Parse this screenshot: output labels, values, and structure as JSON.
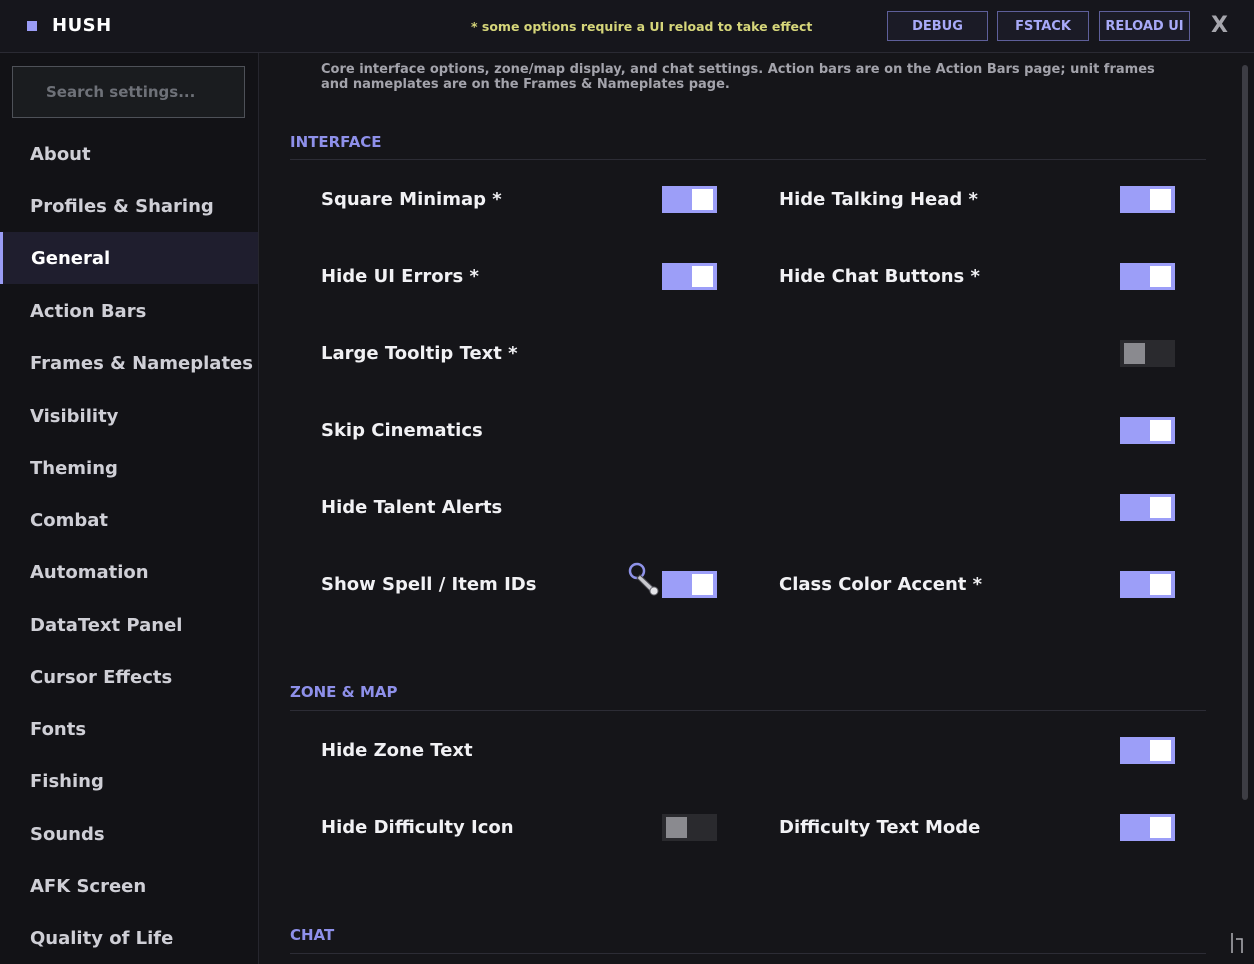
{
  "header": {
    "title": "HUSH",
    "notice": "* some options require a UI reload to take effect",
    "buttons": {
      "debug": "DEBUG",
      "fstack": "FSTACK",
      "reload": "RELOAD UI"
    },
    "close": "X"
  },
  "sidebar": {
    "search_placeholder": "Search settings...",
    "items": [
      {
        "label": "About"
      },
      {
        "label": "Profiles & Sharing"
      },
      {
        "label": "General",
        "active": true
      },
      {
        "label": "Action Bars"
      },
      {
        "label": "Frames & Nameplates"
      },
      {
        "label": "Visibility"
      },
      {
        "label": "Theming"
      },
      {
        "label": "Combat"
      },
      {
        "label": "Automation"
      },
      {
        "label": "DataText Panel"
      },
      {
        "label": "Cursor Effects"
      },
      {
        "label": "Fonts"
      },
      {
        "label": "Fishing"
      },
      {
        "label": "Sounds"
      },
      {
        "label": "AFK Screen"
      },
      {
        "label": "Quality of Life"
      }
    ]
  },
  "main": {
    "description": "Core interface options, zone/map display, and chat settings. Action bars are on the Action Bars page; unit frames and nameplates are on the Frames & Nameplates page.",
    "sections": {
      "interface": {
        "title": "INTERFACE",
        "settings": [
          {
            "label": "Square Minimap *",
            "on": true
          },
          {
            "label": "Hide Talking Head *",
            "on": true
          },
          {
            "label": "Hide UI Errors *",
            "on": true
          },
          {
            "label": "Hide Chat Buttons *",
            "on": true
          },
          {
            "label": "Large Tooltip Text *",
            "on": false
          },
          {
            "label": "Skip Cinematics",
            "on": true
          },
          {
            "label": "Hide Talent Alerts",
            "on": true
          },
          {
            "label": "Show Spell / Item IDs",
            "on": true
          },
          {
            "label": "Class Color Accent *",
            "on": true
          }
        ]
      },
      "zone_map": {
        "title": "ZONE & MAP",
        "settings": [
          {
            "label": "Hide Zone Text",
            "on": true
          },
          {
            "label": "Hide Difficulty Icon",
            "on": false
          },
          {
            "label": "Difficulty Text Mode",
            "on": true
          }
        ]
      },
      "chat": {
        "title": "CHAT"
      }
    }
  },
  "colors": {
    "accent": "#9c9ef8",
    "toggle_off": "#2a2a2e",
    "notice": "#d6d67a",
    "section_title": "#8e90ea"
  },
  "icons": {
    "brand": "square-icon",
    "cursor": "cursor-icon",
    "resize": "resize-grip-icon"
  }
}
